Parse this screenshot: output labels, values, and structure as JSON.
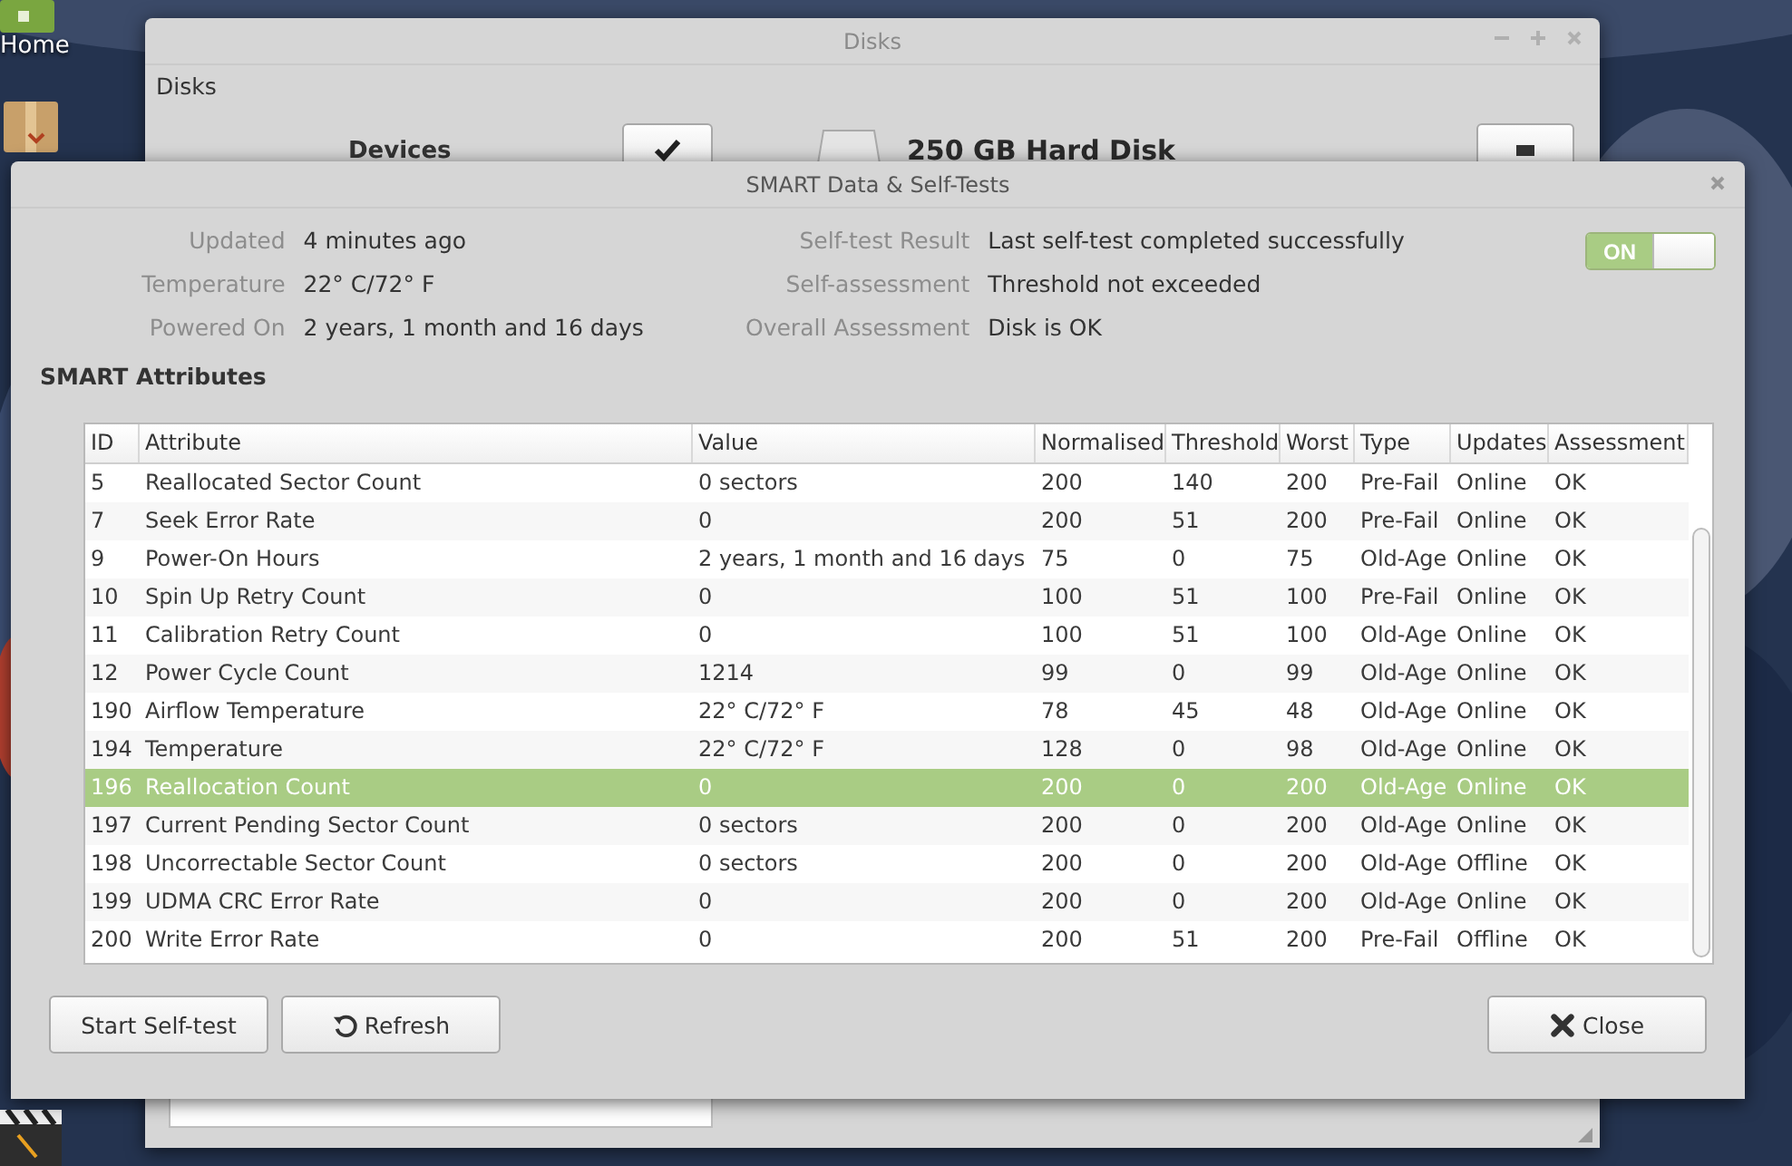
{
  "desktop": {
    "icons": [
      {
        "kind": "folder",
        "label": "Home"
      },
      {
        "kind": "package"
      },
      {
        "kind": "clapperboard"
      }
    ]
  },
  "disks_window": {
    "title": "Disks",
    "heading": "Disks",
    "devices_label": "Devices",
    "device_title": "250 GB Hard Disk"
  },
  "dialog": {
    "title": "SMART Data & Self-Tests",
    "info_left": [
      {
        "label": "Updated",
        "value": "4 minutes ago"
      },
      {
        "label": "Temperature",
        "value": "22° C/72° F"
      },
      {
        "label": "Powered On",
        "value": "2 years, 1 month and 16 days"
      }
    ],
    "info_right": [
      {
        "label": "Self-test Result",
        "value": "Last self-test completed successfully"
      },
      {
        "label": "Self-assessment",
        "value": "Threshold not exceeded"
      },
      {
        "label": "Overall Assessment",
        "value": "Disk is OK"
      }
    ],
    "switch": {
      "label": "ON",
      "on": true
    },
    "section_title": "SMART Attributes",
    "table": {
      "columns": [
        "ID",
        "Attribute",
        "Value",
        "Normalised",
        "Threshold",
        "Worst",
        "Type",
        "Updates",
        "Assessment"
      ],
      "rows": [
        {
          "cells": [
            "5",
            "Reallocated Sector Count",
            "0 sectors",
            "200",
            "140",
            "200",
            "Pre-Fail",
            "Online",
            "OK"
          ],
          "selected": false
        },
        {
          "cells": [
            "7",
            "Seek Error Rate",
            "0",
            "200",
            "51",
            "200",
            "Pre-Fail",
            "Online",
            "OK"
          ],
          "selected": false
        },
        {
          "cells": [
            "9",
            "Power-On Hours",
            "2 years, 1 month and 16 days",
            "75",
            "0",
            "75",
            "Old-Age",
            "Online",
            "OK"
          ],
          "selected": false
        },
        {
          "cells": [
            "10",
            "Spin Up Retry Count",
            "0",
            "100",
            "51",
            "100",
            "Pre-Fail",
            "Online",
            "OK"
          ],
          "selected": false
        },
        {
          "cells": [
            "11",
            "Calibration Retry Count",
            "0",
            "100",
            "51",
            "100",
            "Old-Age",
            "Online",
            "OK"
          ],
          "selected": false
        },
        {
          "cells": [
            "12",
            "Power Cycle Count",
            "1214",
            "99",
            "0",
            "99",
            "Old-Age",
            "Online",
            "OK"
          ],
          "selected": false
        },
        {
          "cells": [
            "190",
            "Airflow Temperature",
            "22° C/72° F",
            "78",
            "45",
            "48",
            "Old-Age",
            "Online",
            "OK"
          ],
          "selected": false
        },
        {
          "cells": [
            "194",
            "Temperature",
            "22° C/72° F",
            "128",
            "0",
            "98",
            "Old-Age",
            "Online",
            "OK"
          ],
          "selected": false
        },
        {
          "cells": [
            "196",
            "Reallocation Count",
            "0",
            "200",
            "0",
            "200",
            "Old-Age",
            "Online",
            "OK"
          ],
          "selected": true
        },
        {
          "cells": [
            "197",
            "Current Pending Sector Count",
            "0 sectors",
            "200",
            "0",
            "200",
            "Old-Age",
            "Online",
            "OK"
          ],
          "selected": false
        },
        {
          "cells": [
            "198",
            "Uncorrectable Sector Count",
            "0 sectors",
            "200",
            "0",
            "200",
            "Old-Age",
            "Offline",
            "OK"
          ],
          "selected": false
        },
        {
          "cells": [
            "199",
            "UDMA CRC Error Rate",
            "0",
            "200",
            "0",
            "200",
            "Old-Age",
            "Online",
            "OK"
          ],
          "selected": false
        },
        {
          "cells": [
            "200",
            "Write Error Rate",
            "0",
            "200",
            "51",
            "200",
            "Pre-Fail",
            "Offline",
            "OK"
          ],
          "selected": false
        }
      ]
    },
    "buttons": [
      {
        "label": "Start Self-test",
        "kind": "plain"
      },
      {
        "label": "Refresh",
        "kind": "refresh"
      },
      {
        "label": "Close",
        "kind": "close"
      }
    ]
  }
}
